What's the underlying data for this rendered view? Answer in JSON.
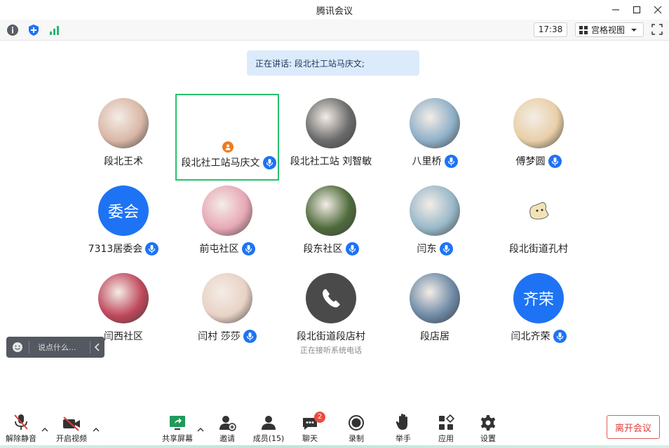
{
  "window": {
    "title": "腾讯会议"
  },
  "toolbar": {
    "clock": "17:38",
    "view_label": "宫格视图"
  },
  "speaker_banner": "正在讲话: 段北社工站马庆文;",
  "participants": [
    {
      "name": "段北王术",
      "mic": false,
      "avatar_kind": "photo",
      "color": "#d9b7a6"
    },
    {
      "name": "段北社工站马庆文",
      "mic": true,
      "avatar_kind": "none",
      "active": true
    },
    {
      "name": "段北社工站 刘智敏",
      "mic": false,
      "avatar_kind": "photo",
      "color": "#6b6b6b"
    },
    {
      "name": "八里桥",
      "mic": true,
      "avatar_kind": "photo",
      "color": "#8fb0c8"
    },
    {
      "name": "傅梦圆",
      "mic": true,
      "avatar_kind": "photo",
      "color": "#e9cfa8"
    },
    {
      "name": "7313居委会",
      "mic": true,
      "avatar_kind": "text",
      "avatar_text": "委会",
      "color": "#1e73f5"
    },
    {
      "name": "前屯社区",
      "mic": true,
      "avatar_kind": "photo",
      "color": "#e7a8b5"
    },
    {
      "name": "段东社区",
      "mic": true,
      "avatar_kind": "photo",
      "color": "#4f6b3c"
    },
    {
      "name": "闫东",
      "mic": true,
      "avatar_kind": "photo",
      "color": "#98b8c9"
    },
    {
      "name": "段北街道孔村",
      "mic": false,
      "avatar_kind": "sticker",
      "color": "#f2e3b5"
    },
    {
      "name": "闫西社区",
      "mic": false,
      "avatar_kind": "photo",
      "color": "#c0485c"
    },
    {
      "name": "闫村 莎莎",
      "mic": true,
      "avatar_kind": "photo",
      "color": "#e8d2c6"
    },
    {
      "name": "段北街道段店村",
      "mic": false,
      "avatar_kind": "phone",
      "status": "正在接听系统电话",
      "color": "#4a4a4a"
    },
    {
      "name": "段店居",
      "mic": false,
      "avatar_kind": "photo",
      "color": "#6d8aa6"
    },
    {
      "name": "闫北齐荣",
      "mic": true,
      "avatar_kind": "text",
      "avatar_text": "齐荣",
      "color": "#1e73f5"
    }
  ],
  "chat": {
    "placeholder": "说点什么..."
  },
  "bottom": {
    "unmute": "解除静音",
    "start_video": "开启视频",
    "share_screen": "共享屏幕",
    "invite": "邀请",
    "members": "成员(15)",
    "chat": "聊天",
    "chat_badge": "2",
    "record": "录制",
    "raise_hand": "举手",
    "apps": "应用",
    "settings": "设置",
    "leave": "离开会议"
  },
  "colors": {
    "accent": "#1e73f5",
    "active_border": "#27c16a",
    "danger": "#e03c3c"
  }
}
